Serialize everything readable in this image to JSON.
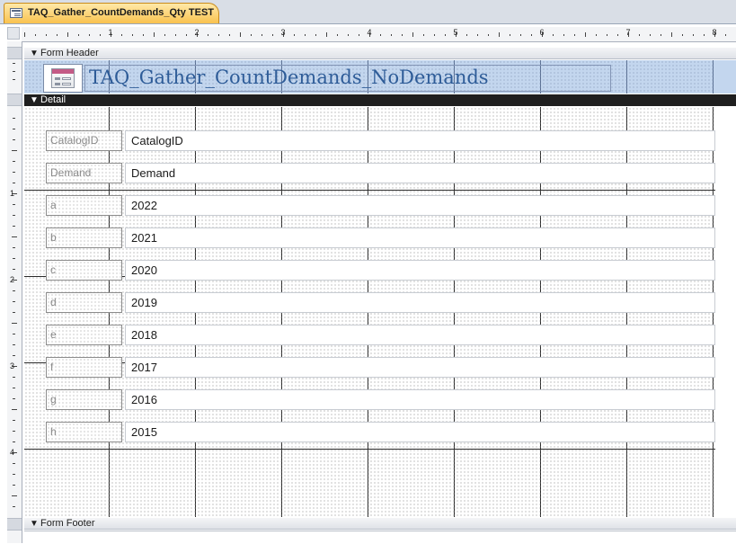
{
  "document_tab": {
    "label": "TAQ_Gather_CountDemands_Qty TEST",
    "icon": "form-icon"
  },
  "ruler": {
    "horizontal_numbers": [
      "1",
      "2",
      "3",
      "4",
      "5",
      "6",
      "7",
      "8"
    ],
    "vertical_numbers": [
      "1",
      "2",
      "3",
      "4"
    ]
  },
  "sections": {
    "form_header": "Form Header",
    "detail": "Detail",
    "form_footer": "Form Footer"
  },
  "header": {
    "title": "TAQ_Gather_CountDemands_NoDemands",
    "logo_icon": "form-logo-icon"
  },
  "detail_rows": [
    {
      "label": "CatalogID",
      "field": "CatalogID"
    },
    {
      "label": "Demand",
      "field": "Demand"
    },
    {
      "label": "a",
      "field": "2022"
    },
    {
      "label": "b",
      "field": "2021"
    },
    {
      "label": "c",
      "field": "2020"
    },
    {
      "label": "d",
      "field": "2019"
    },
    {
      "label": "e",
      "field": "2018"
    },
    {
      "label": "f",
      "field": "2017"
    },
    {
      "label": "g",
      "field": "2016"
    },
    {
      "label": "h",
      "field": "2015"
    }
  ],
  "colors": {
    "tab_active": "#f9c24f",
    "header_band": "#c3d6ee",
    "title_text": "#2e5c98",
    "detail_bar": "#1f1f1f"
  }
}
